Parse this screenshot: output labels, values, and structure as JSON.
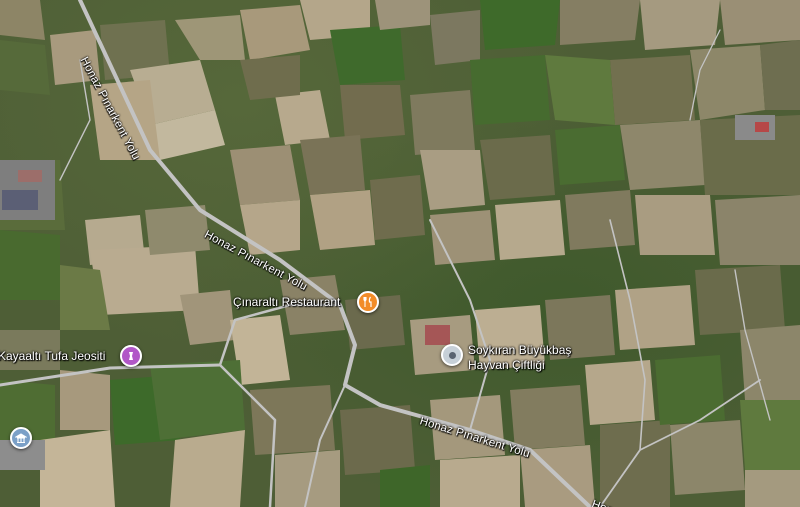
{
  "map": {
    "type": "satellite",
    "roads": [
      {
        "name": "Honaz Pınarkent Yolu"
      },
      {
        "name": "Honaz Pınarkent Yolu"
      },
      {
        "name": "Honaz Pınarkent Yolu"
      },
      {
        "name": "Hona"
      }
    ],
    "places": [
      {
        "name": "Çınaraltı Restaurant",
        "icon": "restaurant-icon",
        "color": "#f28c28"
      },
      {
        "name": "Kayaaltı Tufa Jeositi",
        "icon": "landmark-icon",
        "color": "#b157c7"
      },
      {
        "name": "Soykıran Büyükbaş",
        "name_line2": "Hayvan Çiftliği",
        "icon": "place-icon",
        "color": "#b9c3cc"
      },
      {
        "name": "",
        "icon": "building-icon",
        "color": "#7ba0c7"
      }
    ],
    "colors": {
      "road": "#c3c3c3",
      "field_light": "#b3a58c",
      "field_green": "#5e7a3c",
      "orchard": "#6b6a4e"
    }
  }
}
